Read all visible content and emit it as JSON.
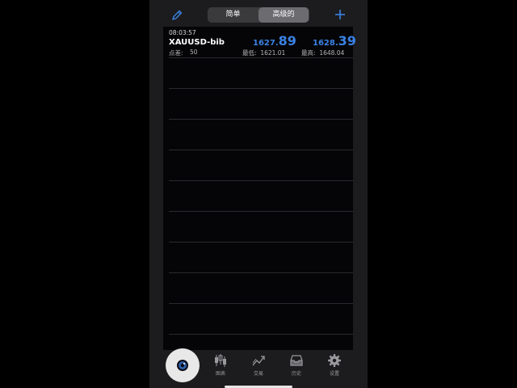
{
  "header": {
    "segments": [
      "简单",
      "高级的"
    ],
    "active_segment": "高级的"
  },
  "quote": {
    "time": "08:03:57",
    "symbol": "XAUUSD-bib",
    "spread_label": "点差:",
    "spread_value": "50",
    "bid_small": "1627.",
    "bid_big": "89",
    "ask_small": "1628.",
    "ask_big": "39",
    "low_label": "最低:",
    "low_value": "1621.01",
    "high_label": "最高:",
    "high_value": "1648.04"
  },
  "tabs": [
    {
      "label": "图表",
      "icon": "candlestick-chart-icon"
    },
    {
      "label": "交易",
      "icon": "trend-line-icon"
    },
    {
      "label": "历史",
      "icon": "inbox-tray-icon"
    },
    {
      "label": "设置",
      "icon": "gear-icon"
    }
  ],
  "colors": {
    "accent": "#3b82e4",
    "background": "#1c1c1e",
    "list_background": "#050507"
  }
}
